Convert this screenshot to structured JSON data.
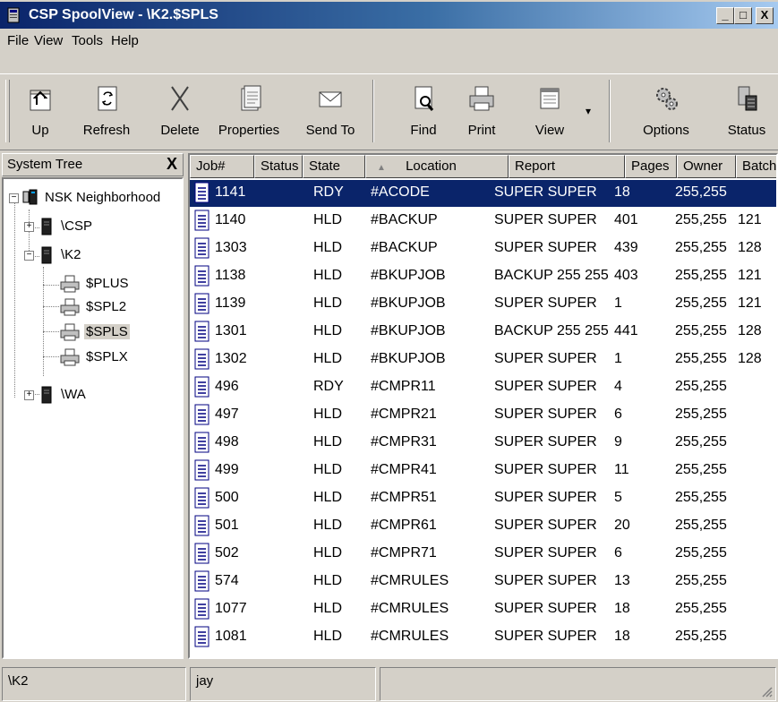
{
  "window": {
    "title": "CSP SpoolView - \\K2.$SPLS",
    "minimize": "_",
    "maximize": "□",
    "close": "X"
  },
  "menu": [
    "File",
    "View",
    "Tools",
    "Help"
  ],
  "toolbar": {
    "up": "Up",
    "refresh": "Refresh",
    "delete": "Delete",
    "properties": "Properties",
    "send_to": "Send To",
    "find": "Find",
    "print": "Print",
    "view": "View",
    "options": "Options",
    "status": "Status"
  },
  "tree": {
    "header": "System Tree",
    "close": "X",
    "nodes": {
      "root": "NSK Neighborhood",
      "csp": "\\CSP",
      "k2": "\\K2",
      "plus": "$PLUS",
      "spl2": "$SPL2",
      "spls": "$SPLS",
      "splx": "$SPLX",
      "wa": "\\WA"
    }
  },
  "list": {
    "columns": [
      "Job#",
      "Status",
      "State",
      "Location",
      "Report",
      "Pages",
      "Owner",
      "Batch"
    ],
    "sort_indicator": "▲",
    "rows": [
      {
        "job": "1141",
        "status": "",
        "state": "RDY",
        "location": "#ACODE",
        "report": "SUPER  SUPER",
        "pages": "18",
        "owner": "255,255",
        "batch": ""
      },
      {
        "job": "1140",
        "status": "",
        "state": "HLD",
        "location": "#BACKUP",
        "report": "SUPER  SUPER",
        "pages": "401",
        "owner": "255,255",
        "batch": "121"
      },
      {
        "job": "1303",
        "status": "",
        "state": "HLD",
        "location": "#BACKUP",
        "report": "SUPER  SUPER",
        "pages": "439",
        "owner": "255,255",
        "batch": "128"
      },
      {
        "job": "1138",
        "status": "",
        "state": "HLD",
        "location": "#BKUPJOB",
        "report": "BACKUP  255 255",
        "pages": "403",
        "owner": "255,255",
        "batch": "121"
      },
      {
        "job": "1139",
        "status": "",
        "state": "HLD",
        "location": "#BKUPJOB",
        "report": "SUPER  SUPER",
        "pages": "1",
        "owner": "255,255",
        "batch": "121"
      },
      {
        "job": "1301",
        "status": "",
        "state": "HLD",
        "location": "#BKUPJOB",
        "report": "BACKUP  255 255",
        "pages": "441",
        "owner": "255,255",
        "batch": "128"
      },
      {
        "job": "1302",
        "status": "",
        "state": "HLD",
        "location": "#BKUPJOB",
        "report": "SUPER  SUPER",
        "pages": "1",
        "owner": "255,255",
        "batch": "128"
      },
      {
        "job": "496",
        "status": "",
        "state": "RDY",
        "location": "#CMPR11",
        "report": "SUPER  SUPER",
        "pages": "4",
        "owner": "255,255",
        "batch": ""
      },
      {
        "job": "497",
        "status": "",
        "state": "HLD",
        "location": "#CMPR21",
        "report": "SUPER  SUPER",
        "pages": "6",
        "owner": "255,255",
        "batch": ""
      },
      {
        "job": "498",
        "status": "",
        "state": "HLD",
        "location": "#CMPR31",
        "report": "SUPER  SUPER",
        "pages": "9",
        "owner": "255,255",
        "batch": ""
      },
      {
        "job": "499",
        "status": "",
        "state": "HLD",
        "location": "#CMPR41",
        "report": "SUPER  SUPER",
        "pages": "11",
        "owner": "255,255",
        "batch": ""
      },
      {
        "job": "500",
        "status": "",
        "state": "HLD",
        "location": "#CMPR51",
        "report": "SUPER  SUPER",
        "pages": "5",
        "owner": "255,255",
        "batch": ""
      },
      {
        "job": "501",
        "status": "",
        "state": "HLD",
        "location": "#CMPR61",
        "report": "SUPER  SUPER",
        "pages": "20",
        "owner": "255,255",
        "batch": ""
      },
      {
        "job": "502",
        "status": "",
        "state": "HLD",
        "location": "#CMPR71",
        "report": "SUPER  SUPER",
        "pages": "6",
        "owner": "255,255",
        "batch": ""
      },
      {
        "job": "574",
        "status": "",
        "state": "HLD",
        "location": "#CMRULES",
        "report": "SUPER  SUPER",
        "pages": "13",
        "owner": "255,255",
        "batch": ""
      },
      {
        "job": "1077",
        "status": "",
        "state": "HLD",
        "location": "#CMRULES",
        "report": "SUPER  SUPER",
        "pages": "18",
        "owner": "255,255",
        "batch": ""
      },
      {
        "job": "1081",
        "status": "",
        "state": "HLD",
        "location": "#CMRULES",
        "report": "SUPER  SUPER",
        "pages": "18",
        "owner": "255,255",
        "batch": ""
      }
    ]
  },
  "statusbar": {
    "path": "\\K2",
    "user": "jay",
    "extra": ""
  },
  "colors": {
    "selection": "#0a246a",
    "title_start": "#0a246a",
    "title_end": "#a6caf0",
    "face": "#d4d0c8"
  },
  "icons": [
    "app-icon",
    "up-folder-icon",
    "refresh-icon",
    "delete-icon",
    "properties-icon",
    "envelope-icon",
    "find-icon",
    "printer-icon",
    "view-icon",
    "gear-icon",
    "status-icon",
    "server-icon",
    "printer-icon",
    "document-icon"
  ]
}
